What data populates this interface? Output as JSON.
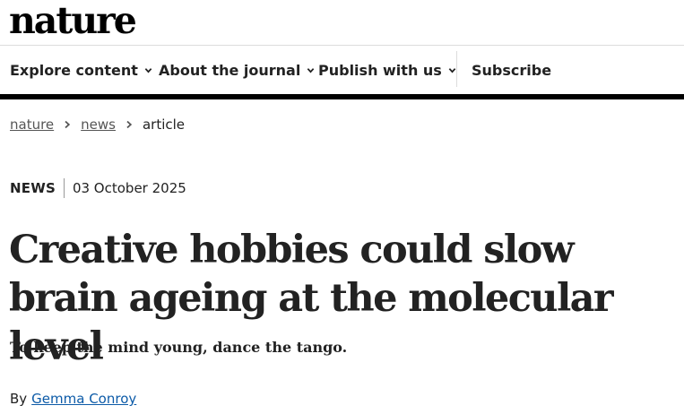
{
  "brand": {
    "logo_text": "nature"
  },
  "nav": {
    "items": [
      {
        "label": "Explore content",
        "icon": "chevron-down-icon"
      },
      {
        "label": "About the journal",
        "icon": "chevron-down-icon"
      },
      {
        "label": "Publish with us",
        "icon": "chevron-down-icon"
      }
    ],
    "subscribe_label": "Subscribe"
  },
  "breadcrumb": {
    "items": [
      {
        "label": "nature"
      },
      {
        "label": "news"
      }
    ],
    "current": "article",
    "separator_icon": "chevron-right-icon"
  },
  "article": {
    "type": "NEWS",
    "date": "03 October 2025",
    "title": "Creative hobbies could slow brain ageing at the molecular level",
    "standfirst": "To keep the mind young, dance the tango.",
    "byline_prefix": "By",
    "author": "Gemma Conroy"
  },
  "colors": {
    "text": "#222222",
    "link": "#0d5ba8",
    "nav_underline": "#000000",
    "divider": "#dcdcdc"
  }
}
